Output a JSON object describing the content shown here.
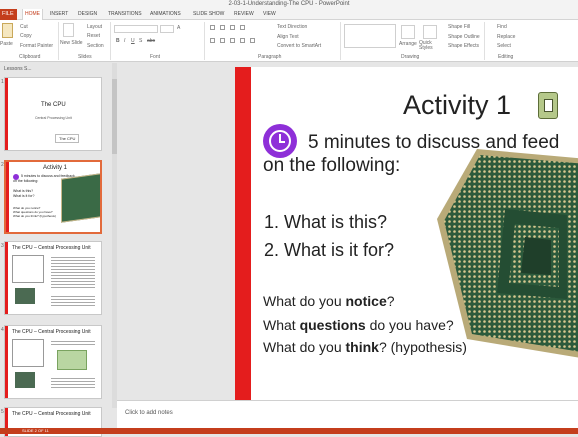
{
  "window": {
    "title": "2-03-1-Understanding-The CPU - PowerPoint"
  },
  "ribbon": {
    "file_tab": "FILE",
    "tabs": [
      "HOME",
      "INSERT",
      "DESIGN",
      "TRANSITIONS",
      "ANIMATIONS",
      "SLIDE SHOW",
      "REVIEW",
      "VIEW"
    ],
    "active_tab": "HOME",
    "clipboard": {
      "cut": "Cut",
      "copy": "Copy",
      "format_painter": "Format Painter",
      "paste": "Paste",
      "label": "Clipboard"
    },
    "slides": {
      "new_slide": "New Slide",
      "layout": "Layout",
      "reset": "Reset",
      "section": "Section",
      "label": "Slides"
    },
    "font": {
      "label": "Font",
      "bold": "B",
      "italic": "I",
      "underline": "U",
      "strike": "S",
      "shadow": "abc",
      "aa": "A"
    },
    "paragraph": {
      "text_direction": "Text Direction",
      "align_text": "Align Text",
      "smartart": "Convert to SmartArt",
      "label": "Paragraph"
    },
    "drawing": {
      "arrange": "Arrange",
      "quick_styles": "Quick Styles",
      "shape_fill": "Shape Fill",
      "shape_outline": "Shape Outline",
      "shape_effects": "Shape Effects",
      "label": "Drawing"
    },
    "editing": {
      "find": "Find",
      "replace": "Replace",
      "select": "Select",
      "label": "Editing"
    }
  },
  "slides_panel": {
    "header": "Lessons S...",
    "thumbnails": [
      {
        "number": "1",
        "title": "The CPU",
        "subtitle": "Central Processing Unit",
        "button": "The CPU"
      },
      {
        "number": "2",
        "title": "Activity 1",
        "lines": [
          "5 minutes to discuss and feedback",
          "on the following:",
          "What is this?",
          "What is it for?",
          "What do you notice?",
          "What questions do you have?",
          "What do you think? (hypothesis)"
        ]
      },
      {
        "number": "3",
        "title": "The CPU – Central Processing Unit"
      },
      {
        "number": "4",
        "title": "The CPU – Central Processing Unit"
      },
      {
        "number": "5",
        "title": "The CPU – Central Processing Unit"
      }
    ]
  },
  "slide": {
    "title": "Activity 1",
    "line1": "5 minutes to discuss and feed",
    "line2": "on the following:",
    "q1": "1.  What is this?",
    "q2": "2.  What is it for?",
    "p1_pre": "What do you ",
    "p1_bold": "notice",
    "p1_post": "?",
    "p2_pre": "What ",
    "p2_bold": "questions",
    "p2_post": " do you have?",
    "p3_pre": "What do you ",
    "p3_bold": "think",
    "p3_post": "? (hypothesis)"
  },
  "notes": {
    "placeholder": "Click to add notes"
  },
  "status": {
    "text": "SLIDE 2 OF 11"
  },
  "colors": {
    "accent": "#c43e1c",
    "slide_bar": "#e41d1d",
    "timer": "#8e2fd8",
    "pcb": "#2f5e3e"
  }
}
